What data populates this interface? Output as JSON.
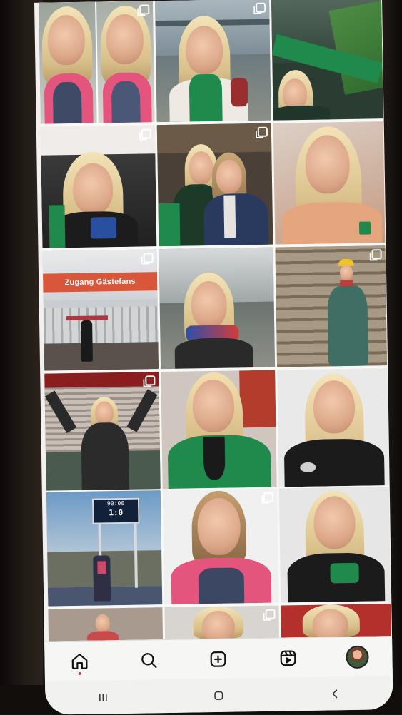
{
  "grid": {
    "tiles": [
      {
        "row": 1,
        "col": 1,
        "name": "post-selfie-stadium-split",
        "multi": true
      },
      {
        "row": 1,
        "col": 2,
        "name": "post-selfie-river-bridge",
        "multi": true
      },
      {
        "row": 1,
        "col": 3,
        "name": "post-selfie-stands-scarf",
        "multi": false
      },
      {
        "row": 2,
        "col": 1,
        "name": "post-selfie-crowd",
        "multi": true
      },
      {
        "row": 2,
        "col": 2,
        "name": "post-group-fans",
        "multi": true
      },
      {
        "row": 2,
        "col": 3,
        "name": "post-selfie-orange-wall",
        "multi": false
      },
      {
        "row": 3,
        "col": 1,
        "name": "post-guest-entrance",
        "multi": true,
        "sign_text": "Zugang Gästefans"
      },
      {
        "row": 3,
        "col": 2,
        "name": "post-selfie-riverside-scarf",
        "multi": false
      },
      {
        "row": 3,
        "col": 3,
        "name": "post-hardhat-tour",
        "multi": true
      },
      {
        "row": 4,
        "col": 1,
        "name": "post-stadium-arms-up",
        "multi": true
      },
      {
        "row": 4,
        "col": 2,
        "name": "post-selfie-green-hoodie",
        "multi": false
      },
      {
        "row": 4,
        "col": 3,
        "name": "post-selfie-black-shirt",
        "multi": false
      },
      {
        "row": 5,
        "col": 1,
        "name": "post-scoreboard",
        "multi": false,
        "scoreboard_time": "90:00",
        "scoreboard_score": "1:0"
      },
      {
        "row": 5,
        "col": 2,
        "name": "post-selfie-sports-top",
        "multi": true
      },
      {
        "row": 5,
        "col": 3,
        "name": "post-selfie-jersey-shirt",
        "multi": false
      },
      {
        "row": 6,
        "col": 1,
        "name": "post-partial-1",
        "multi": false
      },
      {
        "row": 6,
        "col": 2,
        "name": "post-partial-2",
        "multi": true
      },
      {
        "row": 6,
        "col": 3,
        "name": "post-partial-3",
        "multi": false
      }
    ]
  },
  "tabbar": {
    "items": [
      {
        "name": "home-tab",
        "icon": "home-icon",
        "active": true
      },
      {
        "name": "search-tab",
        "icon": "search-icon",
        "active": false
      },
      {
        "name": "create-tab",
        "icon": "add-square-icon",
        "active": false
      },
      {
        "name": "reels-tab",
        "icon": "reels-icon",
        "active": false
      },
      {
        "name": "profile-tab",
        "icon": "avatar",
        "active": false
      }
    ],
    "active_dot_color": "#e0245e"
  },
  "system_nav": {
    "items": [
      {
        "name": "recents-button",
        "icon": "recents-icon"
      },
      {
        "name": "home-button",
        "icon": "home-pill-icon"
      },
      {
        "name": "back-button",
        "icon": "back-chevron-icon"
      }
    ]
  },
  "colors": {
    "werder_green": "#1f8a4c",
    "pink_top": "#e3557c",
    "sign_orange": "#d8563a"
  }
}
